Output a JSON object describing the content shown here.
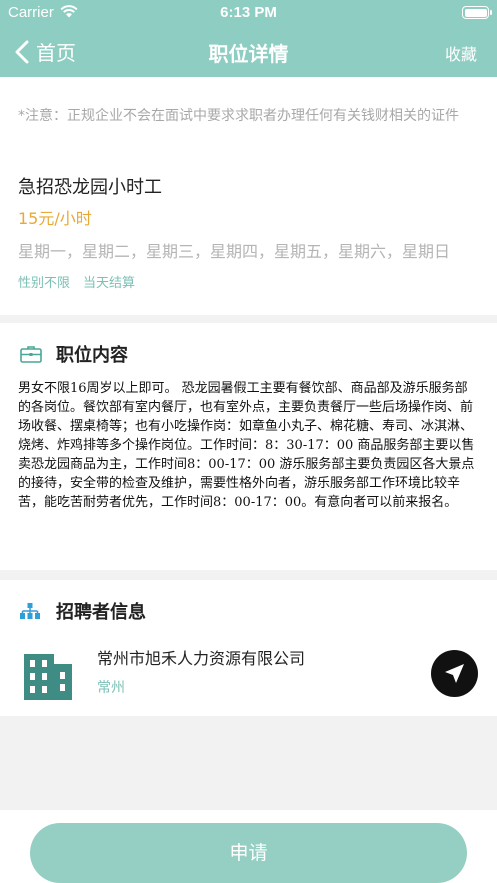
{
  "status_bar": {
    "carrier": "Carrier",
    "time": "6:13 PM"
  },
  "nav": {
    "back_label": "首页",
    "title": "职位详情",
    "favorite_label": "收藏"
  },
  "job": {
    "notice": "*注意：正规企业不会在面试中要求求职者办理任何有关钱财相关的证件",
    "title": "急招恐龙园小时工",
    "salary": "15元/小时",
    "days": "星期一，星期二，星期三，星期四，星期五，星期六，星期日",
    "tags": [
      "性别不限",
      "当天结算"
    ]
  },
  "content_section": {
    "title": "职位内容",
    "description": "男女不限16周岁以上即可。 恐龙园暑假工主要有餐饮部、商品部及游乐服务部的各岗位。餐饮部有室内餐厅，也有室外点，主要负责餐厅一些后场操作岗、前场收餐、摆桌椅等；也有小吃操作岗：如章鱼小丸子、棉花糖、寿司、冰淇淋、烧烤、炸鸡排等多个操作岗位。工作时间：8：30-17：00 商品服务部主要以售卖恐龙园商品为主，工作时间8：00-17：00 游乐服务部主要负责园区各大景点的接待，安全带的检查及维护，需要性格外向者，游乐服务部工作环境比较辛苦，能吃苦耐劳者优先，工作时间8：00-17：00。有意向者可以前来报名。"
  },
  "recruiter_section": {
    "title": "招聘者信息",
    "company_name": "常州市旭禾人力资源有限公司",
    "city": "常州"
  },
  "apply_label": "申请",
  "colors": {
    "accent": "#8dcdc2",
    "salary": "#e9a937",
    "tag": "#7cc0b6",
    "button": "#95cfc4"
  },
  "icons": [
    "wifi-icon",
    "battery-icon",
    "chevron-left-icon",
    "briefcase-icon",
    "org-chart-icon",
    "building-icon",
    "navigation-arrow-icon"
  ]
}
